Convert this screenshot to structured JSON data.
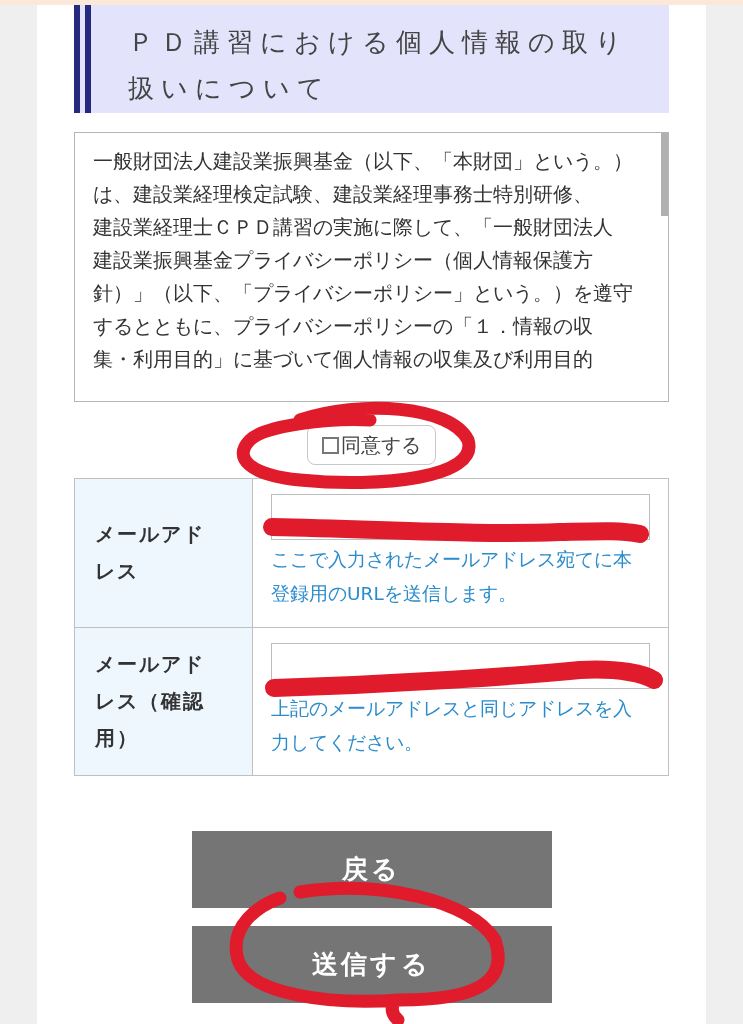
{
  "heading": {
    "lines": [
      "ＰＤ講習における個人情報の取り",
      "扱いについて"
    ]
  },
  "notice": {
    "lines": [
      "一般財団法人建設業振興基金（以下、「本財団」という。）",
      "は、建設業経理検定試験、建設業経理事務士特別研修、",
      "建設業経理士ＣＰＤ講習の実施に際して、「一般財団法人",
      "建設業振興基金プライバシーポリシー（個人情報保護方",
      "針）」（以下、「プライバシーポリシー」という。）を遵守",
      "するとともに、プライバシーポリシーの「１．情報の収",
      "集・利用目的」に基づいて個人情報の収集及び利用目的"
    ]
  },
  "agree": {
    "label": "同意する",
    "checked": false
  },
  "form": {
    "rows": [
      {
        "label_lines": [
          "メールアド",
          "レス"
        ],
        "help_lines": [
          "ここで入力されたメールアドレス宛てに本",
          "登録用のURLを送信します。"
        ]
      },
      {
        "label_lines": [
          "メールアド",
          "レス（確認",
          "用）"
        ],
        "help_lines": [
          "上記のメールアドレスと同じアドレスを入",
          "力してください。"
        ]
      }
    ]
  },
  "buttons": [
    {
      "label": "戻る"
    },
    {
      "label": "送信する"
    }
  ]
}
